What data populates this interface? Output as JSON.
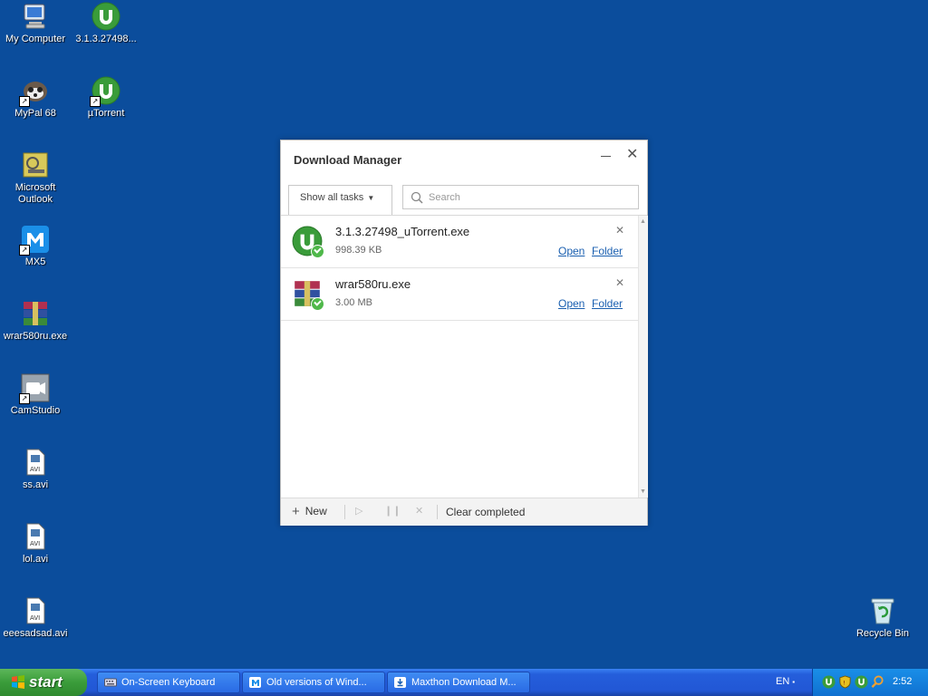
{
  "desktop": {
    "icons": [
      {
        "label": "My Computer",
        "icon": "my-computer-icon"
      },
      {
        "label": "3.1.3.27498...",
        "icon": "utorrent-icon"
      },
      {
        "label": "MyPal 68",
        "icon": "mypal-icon"
      },
      {
        "label": "µTorrent",
        "icon": "utorrent-icon"
      },
      {
        "label": "Microsoft Outlook",
        "icon": "outlook-icon"
      },
      {
        "label": "MX5",
        "icon": "maxthon-icon"
      },
      {
        "label": "wrar580ru.exe",
        "icon": "winrar-icon"
      },
      {
        "label": "CamStudio",
        "icon": "camstudio-icon"
      },
      {
        "label": "ss.avi",
        "icon": "avi-file-icon"
      },
      {
        "label": "lol.avi",
        "icon": "avi-file-icon"
      },
      {
        "label": "eeesadsad.avi",
        "icon": "avi-file-icon"
      },
      {
        "label": "Recycle Bin",
        "icon": "recycle-bin-icon"
      }
    ]
  },
  "download_manager": {
    "title": "Download Manager",
    "filter_label": "Show all tasks",
    "search_placeholder": "Search",
    "items": [
      {
        "name": "3.1.3.27498_uTorrent.exe",
        "size": "998.39 KB",
        "open": "Open",
        "folder": "Folder"
      },
      {
        "name": "wrar580ru.exe",
        "size": "3.00 MB",
        "open": "Open",
        "folder": "Folder"
      }
    ],
    "footer": {
      "new_label": "New",
      "clear_label": "Clear completed"
    }
  },
  "taskbar": {
    "start_label": "start",
    "buttons": [
      {
        "label": "On-Screen Keyboard"
      },
      {
        "label": "Old versions of Wind..."
      },
      {
        "label": "Maxthon Download M..."
      }
    ],
    "language": "EN",
    "clock": "2:52"
  },
  "colors": {
    "desktop_bg": "#0b4d9c",
    "link": "#1a5fb0",
    "utorrent_green": "#3a9c3a",
    "check_green": "#4fb84a"
  }
}
